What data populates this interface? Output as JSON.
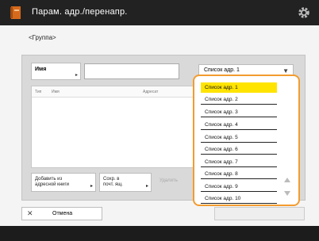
{
  "window": {
    "title": "Парам. адр./перенапр."
  },
  "subtitle": "<Группа>",
  "name_button": {
    "label": "Имя"
  },
  "search": {
    "value": ""
  },
  "list_select": {
    "value": "Список адр. 1"
  },
  "table": {
    "headers": [
      "Тип",
      "Имя",
      "Адресат"
    ]
  },
  "buttons": {
    "add_from_book": [
      "Добавить из",
      "адресной книги"
    ],
    "save_to_folder": [
      "Сохр. в",
      "почт. ящ."
    ],
    "delete": "Удалить",
    "cancel": "Отмена"
  },
  "dropdown": {
    "items": [
      "Список адр. 1",
      "Список адр. 2",
      "Список адр. 3",
      "Список адр. 4",
      "Список адр. 5",
      "Список адр. 6",
      "Список адр. 7",
      "Список адр. 8",
      "Список адр. 9",
      "Список адр. 10"
    ],
    "selected": "Список адр. 1"
  },
  "colors": {
    "highlight": "#ffe400",
    "accent": "#f39c2f",
    "titlebar": "#222222"
  },
  "icons": {
    "app": "address-book-icon",
    "settings": "gear-icon",
    "cancel": "close-icon"
  }
}
